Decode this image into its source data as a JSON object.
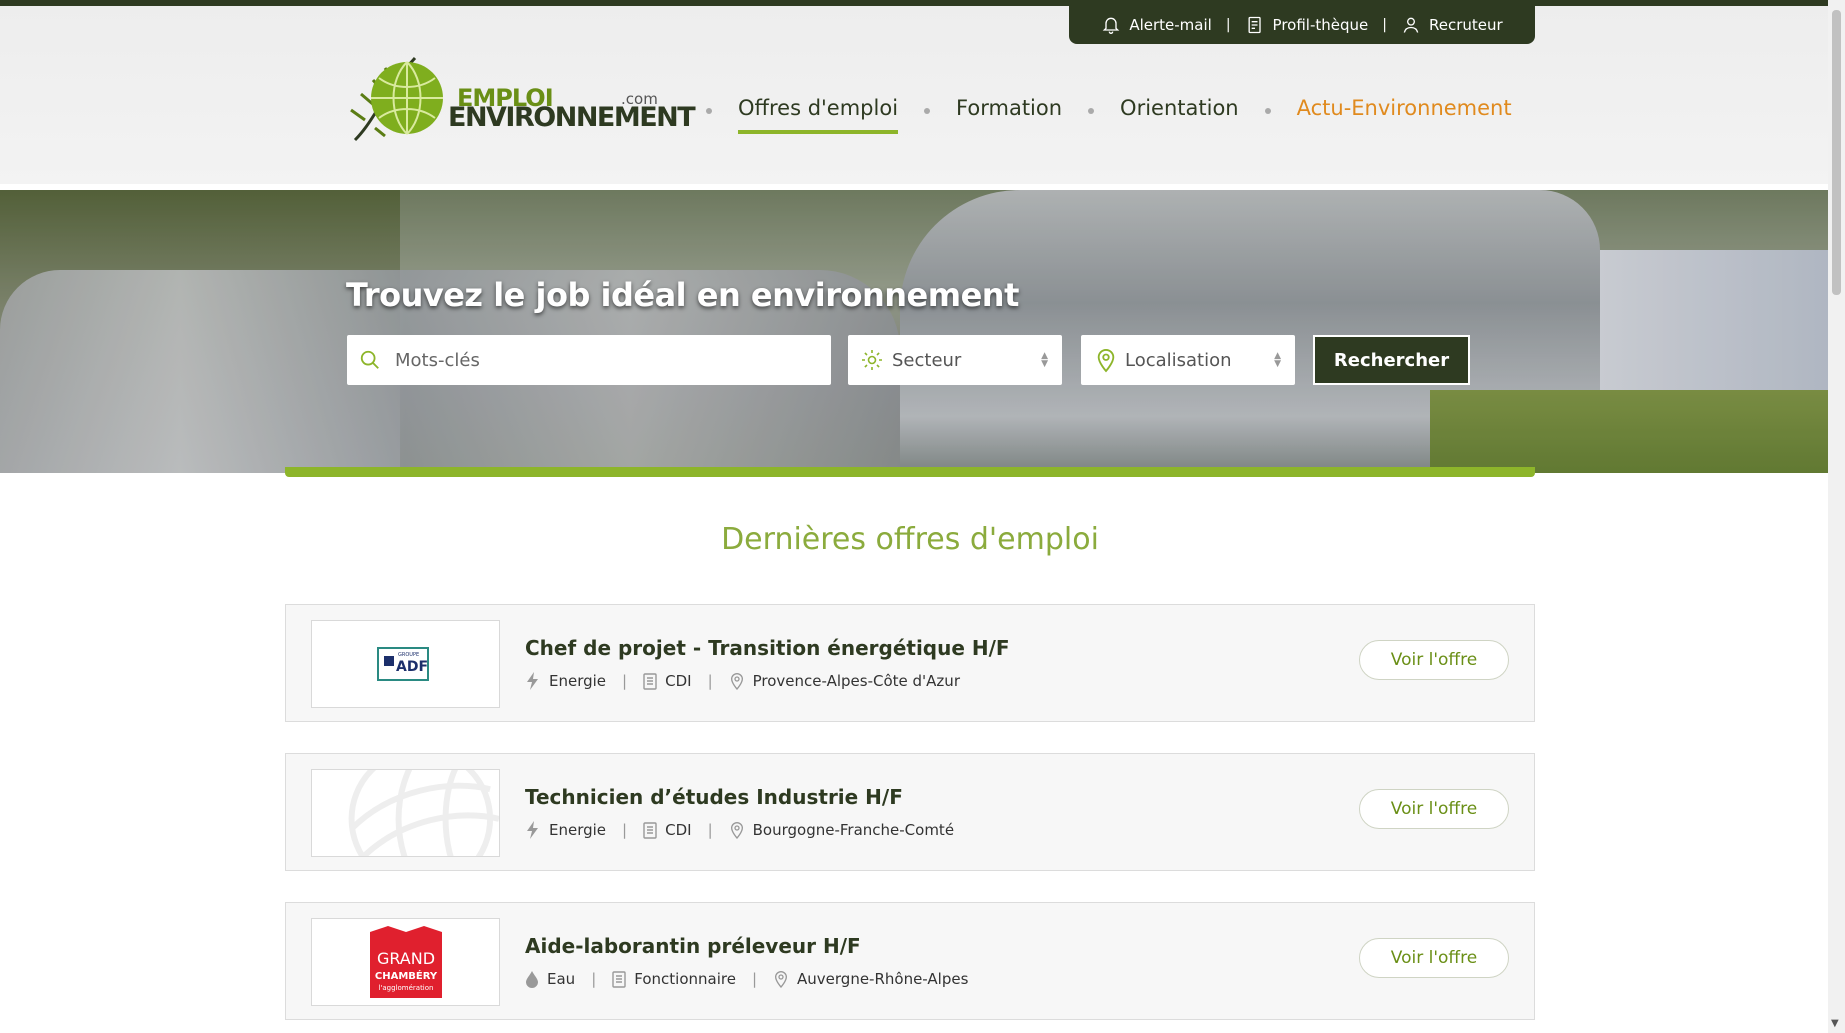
{
  "utility_bar": {
    "items": [
      {
        "label": "Alerte-mail",
        "icon": "bell-icon"
      },
      {
        "label": "Profil-thèque",
        "icon": "profile-doc-icon"
      },
      {
        "label": "Recruteur",
        "icon": "user-icon"
      }
    ],
    "separator": "|"
  },
  "logo": {
    "line1": "EMPLOI",
    "line2": "ENVIRONNEMENT",
    "suffix": ".com"
  },
  "nav": {
    "items": [
      {
        "label": "Offres d'emploi",
        "active": true
      },
      {
        "label": "Formation"
      },
      {
        "label": "Orientation"
      },
      {
        "label": "Actu-Environnement",
        "accent": true
      }
    ]
  },
  "hero": {
    "title": "Trouvez le job idéal en environnement",
    "keywords_placeholder": "Mots-clés",
    "sector_label": "Secteur",
    "location_label": "Localisation",
    "search_button": "Rechercher"
  },
  "listing": {
    "title": "Dernières offres d'emploi",
    "jobs": [
      {
        "title": "Chef de projet - Transition énergétique H/F",
        "sector": "Energie",
        "sector_icon": "lightning-icon",
        "contract": "CDI",
        "location": "Provence-Alpes-Côte d'Azur",
        "button": "Voir l'offre",
        "company_logo": "ADF",
        "logo_small": "GROUPE"
      },
      {
        "title": "Technicien d’études Industrie H/F",
        "sector": "Energie",
        "sector_icon": "lightning-icon",
        "contract": "CDI",
        "location": "Bourgogne-Franche-Comté",
        "button": "Voir l'offre",
        "company_logo": ""
      },
      {
        "title": "Aide-laborantin préleveur H/F",
        "sector": "Eau",
        "sector_icon": "water-drop-icon",
        "contract": "Fonctionnaire",
        "location": "Auvergne-Rhône-Alpes",
        "button": "Voir l'offre",
        "company_logo": "GRAND",
        "logo_line2": "CHAMBÉRY",
        "logo_line3": "l'agglomération"
      }
    ]
  },
  "colors": {
    "dark_green": "#2e3a21",
    "accent_green": "#8db52a",
    "orange": "#e08a1e"
  }
}
